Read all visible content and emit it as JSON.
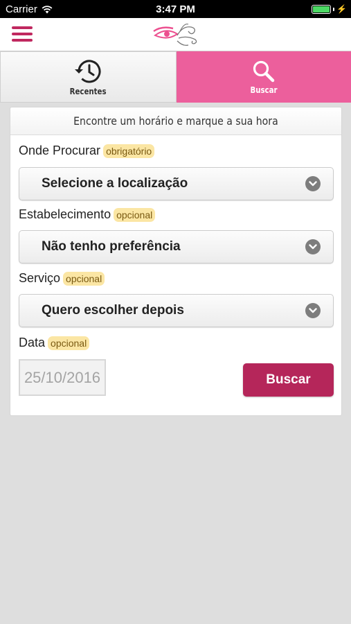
{
  "status_bar": {
    "carrier": "Carrier",
    "time": "3:47 PM"
  },
  "tabs": [
    {
      "label": "Recentes",
      "icon": "history-icon"
    },
    {
      "label": "Buscar",
      "icon": "search-icon",
      "active": true
    }
  ],
  "form": {
    "title": "Encontre um horário e marque a sua hora",
    "location": {
      "label": "Onde Procurar",
      "badge": "obrigatório",
      "value": "Selecione a localização"
    },
    "establishment": {
      "label": "Estabelecimento",
      "badge": "opcional",
      "value": "Não tenho preferência"
    },
    "service": {
      "label": "Serviço",
      "badge": "opcional",
      "value": "Quero escolher depois"
    },
    "date": {
      "label": "Data",
      "badge": "opcional",
      "value": "25/10/2016"
    },
    "submit_label": "Buscar"
  },
  "colors": {
    "brand": "#c0285f",
    "active_tab": "#ec5f9c",
    "button": "#b5265a",
    "badge": "#fbe6a4"
  }
}
